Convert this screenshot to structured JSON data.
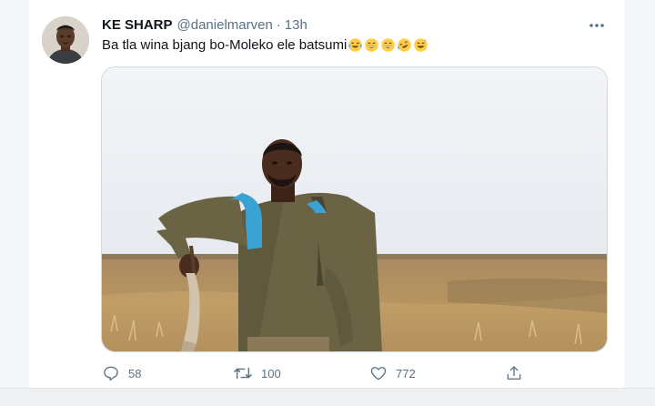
{
  "tweet": {
    "name": "KE SHARP",
    "handle": "@danielmarven",
    "separator": "·",
    "time": "13h",
    "text": "Ba tla wina bjang bo-Moleko ele batsumi",
    "emojis": [
      "face-with-tears-of-joy",
      "grinning-face-with-smiling-eyes",
      "grinning-face-with-smiling-eyes",
      "rolling-on-the-floor-laughing",
      "grinning-face-with-sweat"
    ],
    "media_alt": "Man with a blue backpack holding a knobkerrie in an open grassland field"
  },
  "actions": {
    "reply": {
      "icon": "reply-icon",
      "count": "58"
    },
    "retweet": {
      "icon": "retweet-icon",
      "count": "100"
    },
    "like": {
      "icon": "heart-icon",
      "count": "772"
    },
    "share": {
      "icon": "share-icon"
    }
  },
  "colors": {
    "text": "#0f1419",
    "secondary": "#5b7083",
    "border": "#cfd9de",
    "sky": "#eef2f6",
    "field": "#b08a5a"
  }
}
